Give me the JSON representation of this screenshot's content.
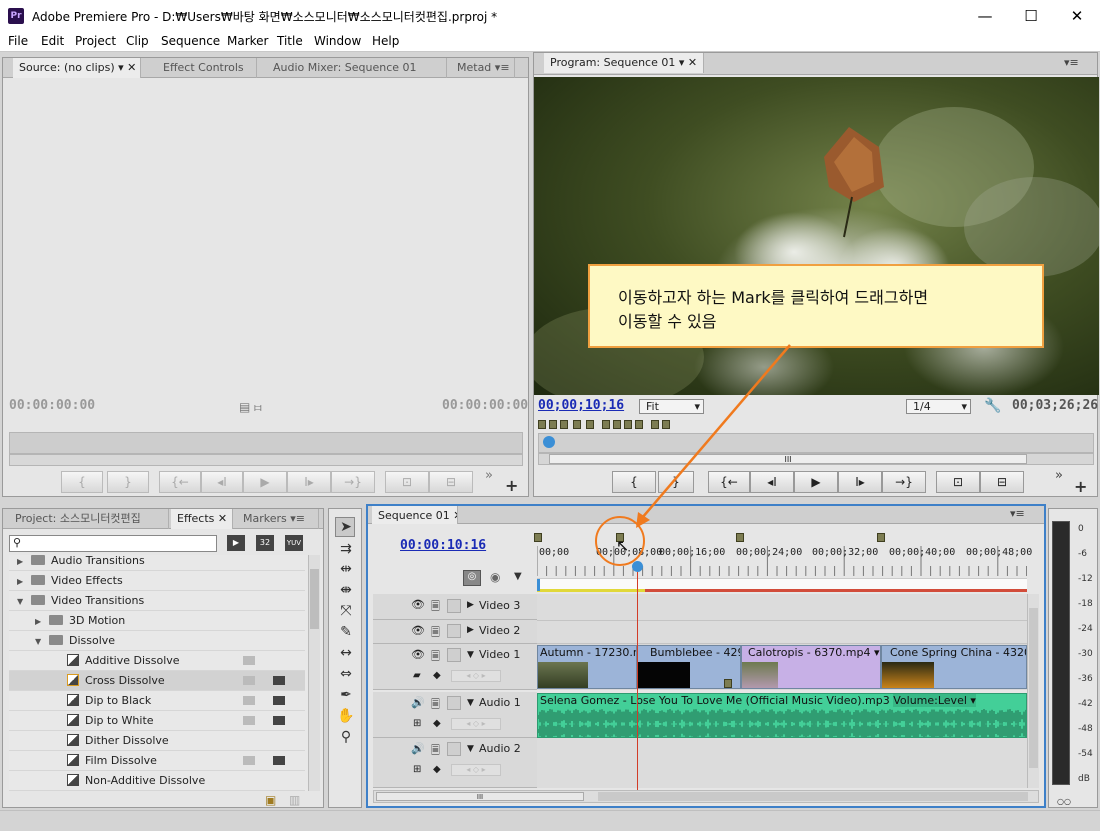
{
  "window": {
    "app_icon": "Pr",
    "title": "Adobe Premiere Pro - D:₩Users₩바탕 화면₩소스모니터₩소스모니터컷편집.prproj *",
    "minimize": "—",
    "maximize": "☐",
    "close": "✕"
  },
  "menu": [
    "File",
    "Edit",
    "Project",
    "Clip",
    "Sequence",
    "Marker",
    "Title",
    "Window",
    "Help"
  ],
  "source_panel": {
    "tabs": [
      "Source: (no clips)",
      "Effect Controls",
      "Audio Mixer: Sequence 01",
      "Metad"
    ],
    "tc_in": "00:00:00:00",
    "tc_out": "00:00:00:00"
  },
  "program_panel": {
    "tab": "Program: Sequence 01",
    "timecode": "00;00;10;16",
    "zoom": "Fit",
    "quality": "1/4",
    "duration": "00;03;26;26",
    "scrub_pos": "III"
  },
  "callout": {
    "line1": "이동하고자 하는 Mark를 클릭하여 드래그하면",
    "line2": "이동할 수 있음"
  },
  "project_panel": {
    "tabs": [
      "Project: 소스모니터컷편집",
      "Effects",
      "Markers"
    ],
    "badges": [
      "32",
      "YUV"
    ],
    "tree": [
      {
        "label": "Audio Transitions",
        "type": "folder",
        "indent": 0
      },
      {
        "label": "Video Effects",
        "type": "folder",
        "indent": 0
      },
      {
        "label": "Video Transitions",
        "type": "folder",
        "indent": 0,
        "open": true
      },
      {
        "label": "3D Motion",
        "type": "folder",
        "indent": 1
      },
      {
        "label": "Dissolve",
        "type": "folder",
        "indent": 1,
        "open": true
      },
      {
        "label": "Additive Dissolve",
        "type": "fx",
        "indent": 2
      },
      {
        "label": "Cross Dissolve",
        "type": "fx",
        "indent": 2,
        "selected": true
      },
      {
        "label": "Dip to Black",
        "type": "fx",
        "indent": 2
      },
      {
        "label": "Dip to White",
        "type": "fx",
        "indent": 2
      },
      {
        "label": "Dither Dissolve",
        "type": "fx",
        "indent": 2
      },
      {
        "label": "Film Dissolve",
        "type": "fx",
        "indent": 2
      },
      {
        "label": "Non-Additive Dissolve",
        "type": "fx",
        "indent": 2
      }
    ]
  },
  "timeline": {
    "tab": "Sequence 01",
    "timecode": "00:00:10:16",
    "scroll_grip": "III",
    "ruler": [
      "00;00",
      "00;00;08;00",
      "00;00;16;00",
      "00;00;24;00",
      "00;00;32;00",
      "00;00;40;00",
      "00;00;48;00"
    ],
    "tracks": {
      "video3": "Video 3",
      "video2": "Video 2",
      "video1": "Video 1",
      "audio1": "Audio 1",
      "audio2": "Audio 2"
    },
    "clips": [
      "Autumn - 17230.mp",
      "Bumblebee - 429",
      "Calotropis - 6370.mp4 ▾",
      "Cone Spring China - 43206."
    ],
    "audio_clip": "Selena Gomez - Lose You To Love Me (Official Music Video).mp3",
    "audio_vol": "Volume:Level ▾"
  },
  "vu_scale": [
    "0",
    "-6",
    "-12",
    "-18",
    "-24",
    "-30",
    "-36",
    "-42",
    "-48",
    "-54",
    "dB"
  ],
  "vu_solo": "○○"
}
